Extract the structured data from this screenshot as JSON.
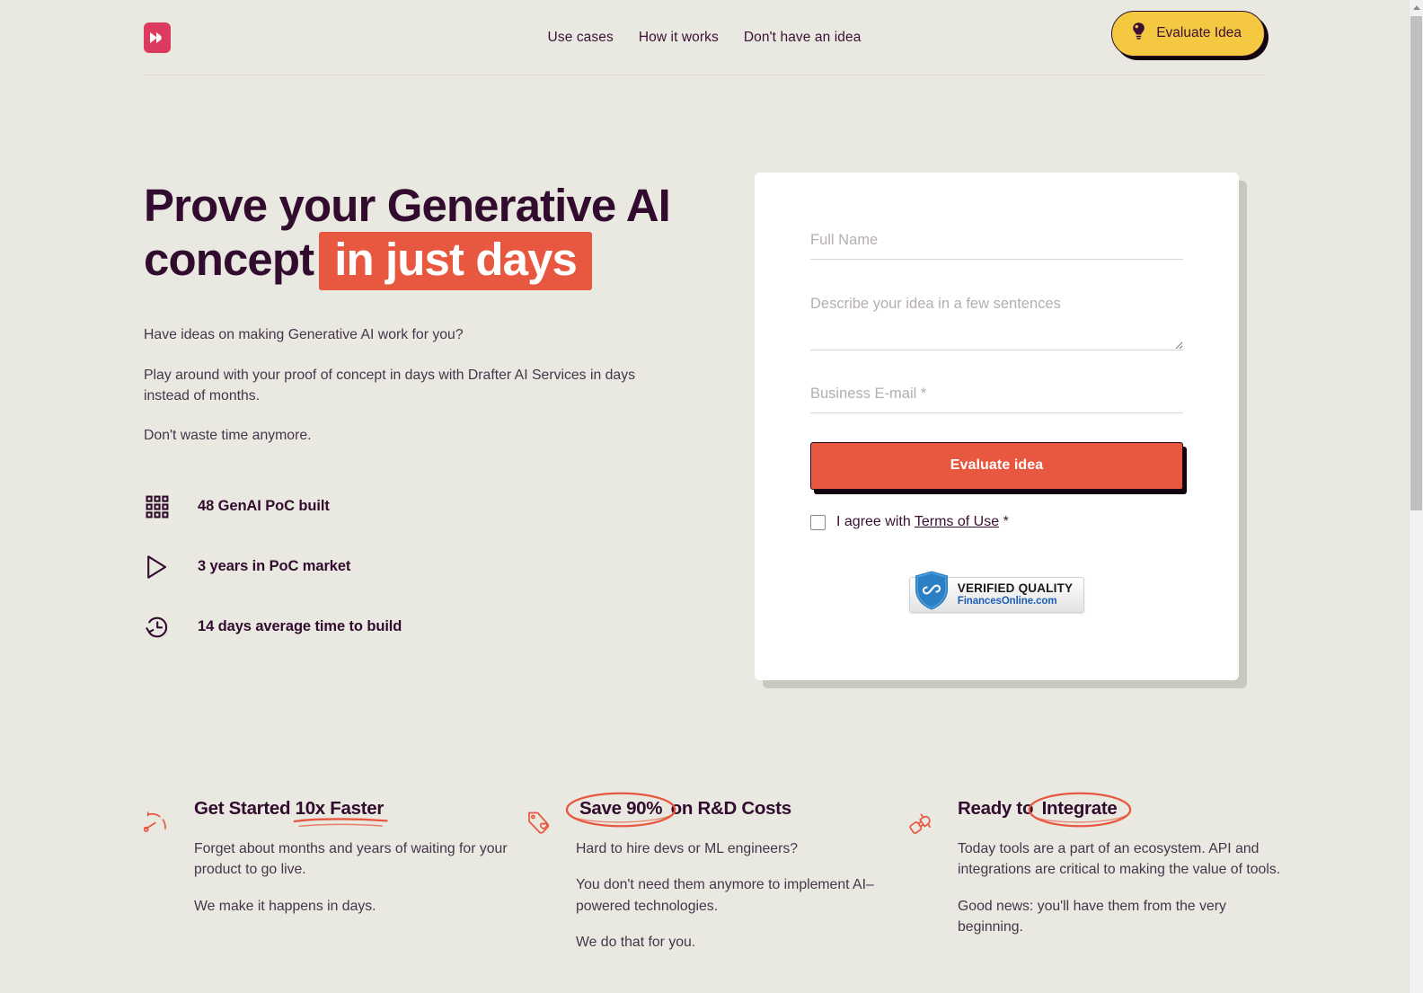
{
  "brand": {
    "logo_icon": "fast-forward-logo"
  },
  "nav": {
    "items": [
      {
        "label": "Use cases"
      },
      {
        "label": "How it works"
      },
      {
        "label": "Don't have an idea"
      }
    ],
    "cta": {
      "label": "Evaluate Idea",
      "icon": "lightbulb-icon"
    }
  },
  "hero": {
    "title_part1": "Prove your Generative AI concept",
    "title_highlight": "in just days",
    "paragraphs": [
      "Have ideas on making Generative AI work for you?",
      "Play around with your proof of concept in days with Drafter AI Services in days instead of months.",
      "Don't waste time anymore."
    ],
    "stats": [
      {
        "icon": "grid-icon",
        "label": "48 GenAI PoC built"
      },
      {
        "icon": "play-triangle-icon",
        "label": "3 years in PoC market"
      },
      {
        "icon": "clock-history-icon",
        "label": "14 days average time to build"
      }
    ]
  },
  "form": {
    "full_name": {
      "placeholder": "Full Name",
      "value": ""
    },
    "idea": {
      "placeholder": "Describe your idea in a few sentences",
      "value": ""
    },
    "email": {
      "placeholder": "Business E-mail *",
      "value": ""
    },
    "submit_label": "Evaluate idea",
    "agree_prefix": "I agree with ",
    "agree_link": "Terms of Use",
    "agree_suffix": " *",
    "checked": false,
    "badge": {
      "title": "VERIFIED QUALITY",
      "subtitle": "FinancesOnline.com",
      "icon": "shield-check-icon"
    }
  },
  "features": [
    {
      "icon": "speedometer-icon",
      "title_plain": "Get Started ",
      "title_mark": "10x Faster",
      "mark_style": "underline",
      "paragraphs": [
        "Forget about months and years of waiting for your product to go live.",
        "We make it happens in days."
      ]
    },
    {
      "icon": "price-tag-heart-icon",
      "title_plain": " on R&D Costs",
      "title_mark": "Save 90%",
      "mark_style": "circle-leading",
      "paragraphs": [
        "Hard to hire devs or ML engineers?",
        "You don't need them anymore to implement AI–powered technologies.",
        "We do that for you."
      ]
    },
    {
      "icon": "plug-connector-icon",
      "title_plain": "Ready to ",
      "title_mark": "Integrate",
      "mark_style": "circle",
      "paragraphs": [
        "Today tools are a part of an ecosystem. API and integrations are critical to making the value of tools.",
        "Good news: you'll have them from the very beginning."
      ]
    }
  ],
  "colors": {
    "background": "#eae9e1",
    "accent_coral": "#e8573f",
    "accent_yellow": "#f5c842",
    "brand_pink": "#dc3b5f",
    "ink": "#320c2e"
  }
}
